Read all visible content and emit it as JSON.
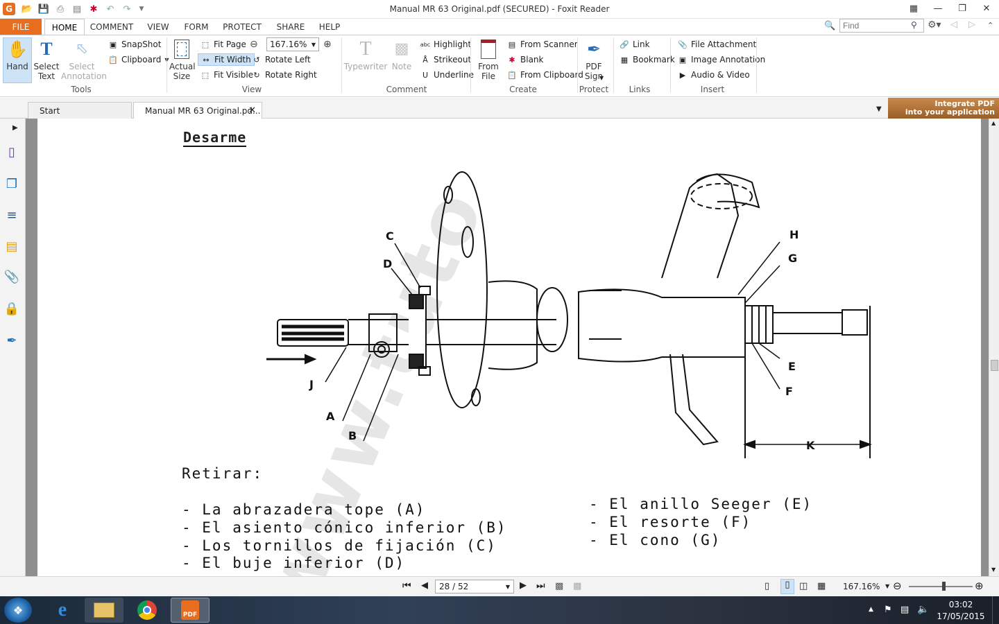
{
  "window": {
    "title": "Manual MR 63 Original.pdf (SECURED) - Foxit Reader",
    "buttons": [
      "restore-layout",
      "minimize",
      "maximize",
      "close"
    ]
  },
  "search": {
    "placeholder": "Find"
  },
  "menu": [
    "FILE",
    "HOME",
    "COMMENT",
    "VIEW",
    "FORM",
    "PROTECT",
    "SHARE",
    "HELP"
  ],
  "ribbon": {
    "tools": {
      "hand": "Hand",
      "select_text": "Select Text",
      "select_annotation": "Select Annotation",
      "snapshot": "SnapShot",
      "clipboard": "Clipboard",
      "label": "Tools"
    },
    "view": {
      "actual_size": "Actual Size",
      "fit_page": "Fit Page",
      "fit_width": "Fit Width",
      "fit_visible": "Fit Visible",
      "zoom": "167.16%",
      "rotate_left": "Rotate Left",
      "rotate_right": "Rotate Right",
      "label": "View"
    },
    "comment": {
      "typewriter": "Typewriter",
      "note": "Note",
      "highlight": "Highlight",
      "strikeout": "Strikeout",
      "underline": "Underline",
      "label": "Comment"
    },
    "create": {
      "from_file": "From File",
      "from_scanner": "From Scanner",
      "blank": "Blank",
      "from_clipboard": "From Clipboard",
      "label": "Create"
    },
    "protect": {
      "pdf_sign": "PDF Sign",
      "label": "Protect"
    },
    "links": {
      "link": "Link",
      "bookmark": "Bookmark",
      "label": "Links"
    },
    "insert": {
      "file_attachment": "File Attachment",
      "image_annotation": "Image Annotation",
      "audio_video": "Audio & Video",
      "label": "Insert"
    }
  },
  "tabs": [
    {
      "label": "Start"
    },
    {
      "label": "Manual MR 63 Original.pd..."
    }
  ],
  "ad": {
    "line1": "Integrate PDF",
    "line2": "into your application"
  },
  "document": {
    "heading": "Desarme",
    "watermark": "www.tuto",
    "labels": {
      "C": "C",
      "D": "D",
      "J": "J",
      "A": "A",
      "B": "B",
      "H": "H",
      "G": "G",
      "E": "E",
      "F": "F",
      "K": "K"
    },
    "retirar": "Retirar:",
    "list_left": [
      "- La abrazadera tope (A)",
      "- El asiento cónico inferior (B)",
      "- Los tornillos de fijación (C)",
      "- El buje inferior (D)"
    ],
    "list_right": [
      "- El anillo Seeger (E)",
      "- El resorte (F)",
      "- El cono (G)"
    ]
  },
  "status": {
    "page": "28 / 52",
    "zoom": "167.16%"
  },
  "taskbar": {
    "time": "03:02",
    "date": "17/05/2015"
  }
}
